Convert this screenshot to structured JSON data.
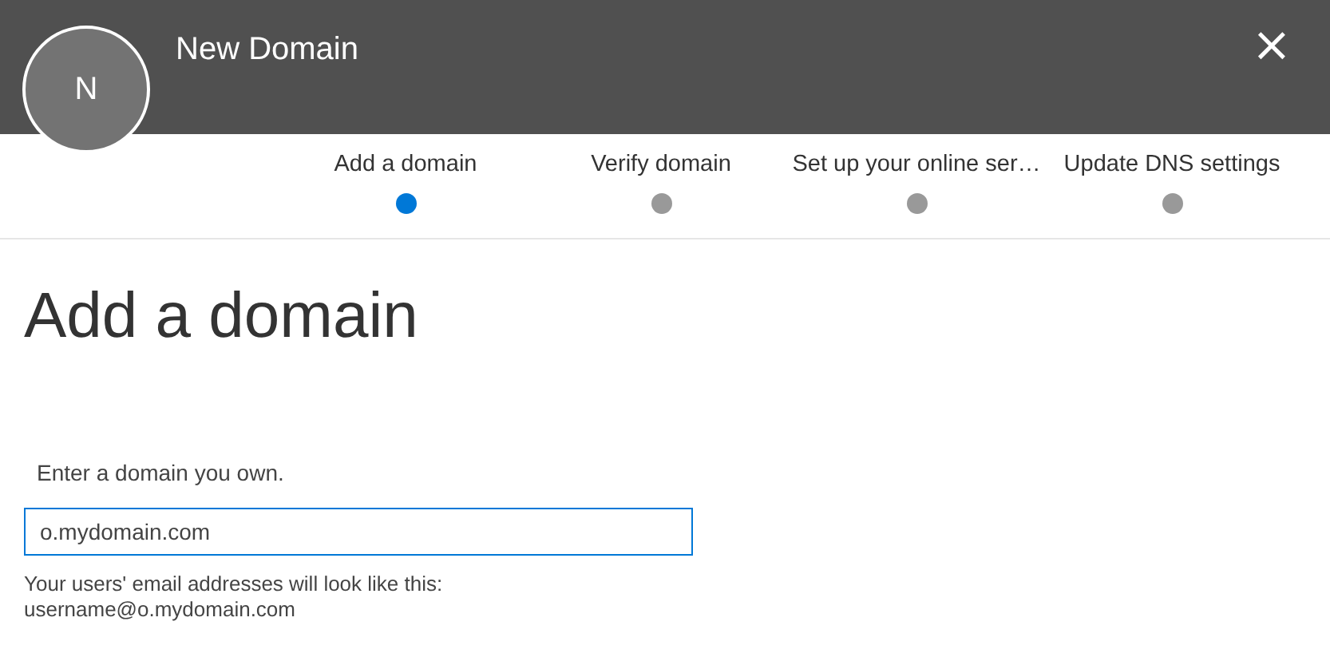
{
  "header": {
    "title": "New Domain",
    "avatar": "N",
    "close": "×"
  },
  "steps": [
    {
      "label": "Add a domain",
      "selected": true
    },
    {
      "label": "Verify domain",
      "selected": false
    },
    {
      "label": "Set up your online ser…",
      "selected": false
    },
    {
      "label": "Update DNS settings",
      "selected": false
    }
  ],
  "page_title": "Add a domain",
  "domain_field": {
    "label": "Enter a domain you own.",
    "value": "o.mydomain.com"
  },
  "hint": [
    "Your users' email addresses will look like this:",
    "username@o.mydomain.com"
  ]
}
